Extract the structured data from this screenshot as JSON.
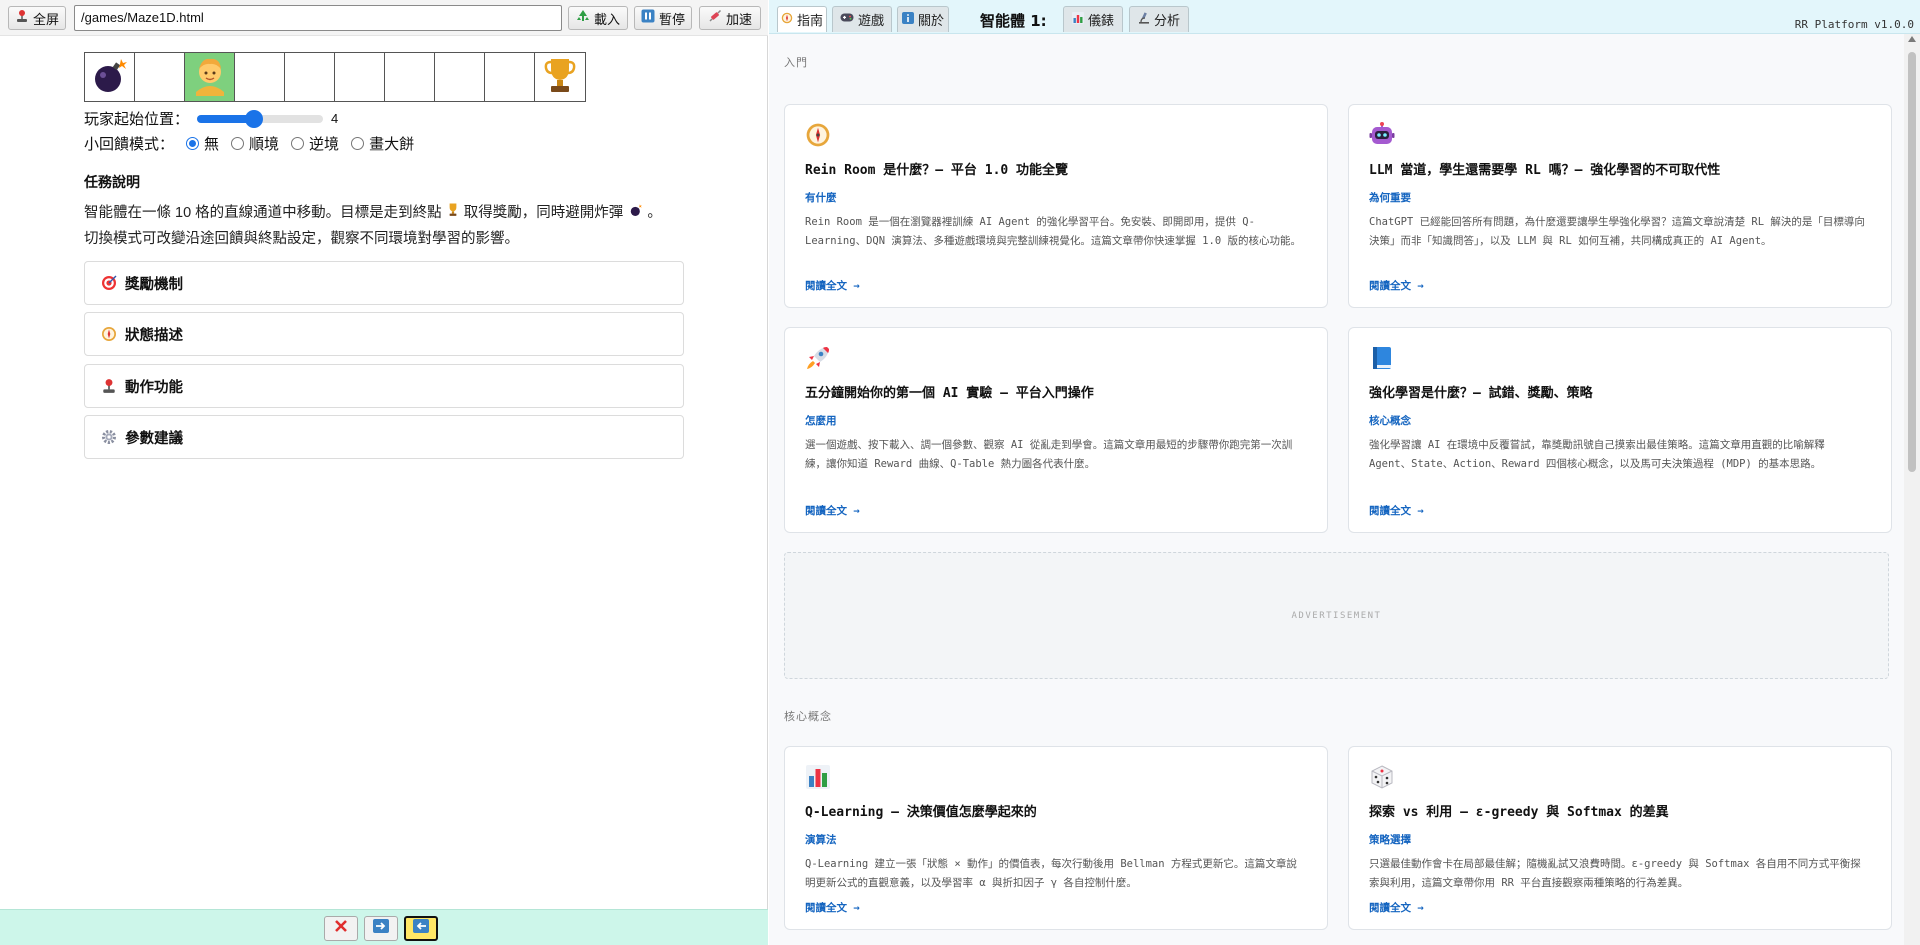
{
  "toolbar": {
    "fullscreen_label": "全屏",
    "url_value": "/games/Maze1D.html",
    "load_label": "載入",
    "pause_label": "暫停",
    "speed_label": "加速"
  },
  "game": {
    "cells": [
      "bomb",
      "empty",
      "player",
      "empty",
      "empty",
      "empty",
      "empty",
      "empty",
      "empty",
      "trophy"
    ],
    "start_label": "玩家起始位置：",
    "start_value": "4",
    "start_fraction": 0.45,
    "mode_label": "小回饋模式：",
    "modes": [
      "無",
      "順境",
      "逆境",
      "畫大餅"
    ],
    "selected_mode": "無"
  },
  "task": {
    "title": "任務說明",
    "desc_part1": "智能體在一條 10 格的直線通道中移動。目標是走到終點",
    "desc_part2": "取得獎勵，同時避開炸彈",
    "desc_part3": "。切換模式可改變沿途回饋與終點設定，觀察不同環境對學習的影響。"
  },
  "accordions": [
    {
      "label": "獎勵機制",
      "icon": "target-icon"
    },
    {
      "label": "狀態描述",
      "icon": "compass-icon"
    },
    {
      "label": "動作功能",
      "icon": "joystick-icon"
    },
    {
      "label": "參數建議",
      "icon": "gear-icon"
    }
  ],
  "right": {
    "tabs": {
      "guide": "指南",
      "games": "遊戲",
      "about": "關於",
      "agent_label": "智能體 1:",
      "dashboard": "儀錶",
      "analysis": "分析"
    },
    "version": "RR Platform v1.0.0",
    "section_intro": "入門",
    "section_core": "核心概念",
    "advertisement": "ADVERTISEMENT",
    "read_more": "閱讀全文 →",
    "cards": [
      {
        "icon": "compass-icon",
        "title": "Rein Room 是什麼？— 平台 1.0 功能全覽",
        "tag": "有什麼",
        "body": "Rein Room 是一個在瀏覽器裡訓練 AI Agent 的強化學習平台。免安裝、即開即用，提供 Q-Learning、DQN 演算法、多種遊戲環境與完整訓練視覺化。這篇文章帶你快速掌握 1.0 版的核心功能。"
      },
      {
        "icon": "robot-icon",
        "title": "LLM 當道，學生還需要學 RL 嗎？— 強化學習的不可取代性",
        "tag": "為何重要",
        "body": "ChatGPT 已經能回答所有問題，為什麼還要讓學生學強化學習？這篇文章說清楚 RL 解決的是「目標導向決策」而非「知識問答」，以及 LLM 與 RL 如何互補，共同構成真正的 AI Agent。"
      },
      {
        "icon": "rocket-icon",
        "title": "五分鐘開始你的第一個 AI 實驗 — 平台入門操作",
        "tag": "怎麼用",
        "body": "選一個遊戲、按下載入、調一個參數、觀察 AI 從亂走到學會。這篇文章用最短的步驟帶你跑完第一次訓練，讓你知道 Reward 曲線、Q-Table 熱力圖各代表什麼。"
      },
      {
        "icon": "book-icon",
        "title": "強化學習是什麼？— 試錯、獎勵、策略",
        "tag": "核心概念",
        "body": "強化學習讓 AI 在環境中反覆嘗試，靠獎勵訊號自己摸索出最佳策略。這篇文章用直觀的比喻解釋 Agent、State、Action、Reward 四個核心概念，以及馬可夫決策過程 (MDP) 的基本思路。"
      },
      {
        "icon": "bar-chart-icon",
        "title": "Q-Learning — 決策價值怎麼學起來的",
        "tag": "演算法",
        "body": "Q-Learning 建立一張「狀態 × 動作」的價值表，每次行動後用 Bellman 方程式更新它。這篇文章說明更新公式的直觀意義，以及學習率 α 與折扣因子 γ 各自控制什麼。"
      },
      {
        "icon": "dice-icon",
        "title": "探索 vs 利用 — ε-greedy 與 Softmax 的差異",
        "tag": "策略選擇",
        "body": "只選最佳動作會卡在局部最佳解；隨機亂試又浪費時間。ε-greedy 與 Softmax 各自用不同方式平衡探索與利用，這篇文章帶你用 RR 平台直接觀察兩種策略的行為差異。"
      }
    ]
  },
  "bottom": {
    "buttons": [
      {
        "name": "stop-button",
        "icon": "close-icon"
      },
      {
        "name": "right-step-button",
        "icon": "right-arrow-icon"
      },
      {
        "name": "left-step-button",
        "icon": "left-arrow-icon"
      }
    ]
  }
}
